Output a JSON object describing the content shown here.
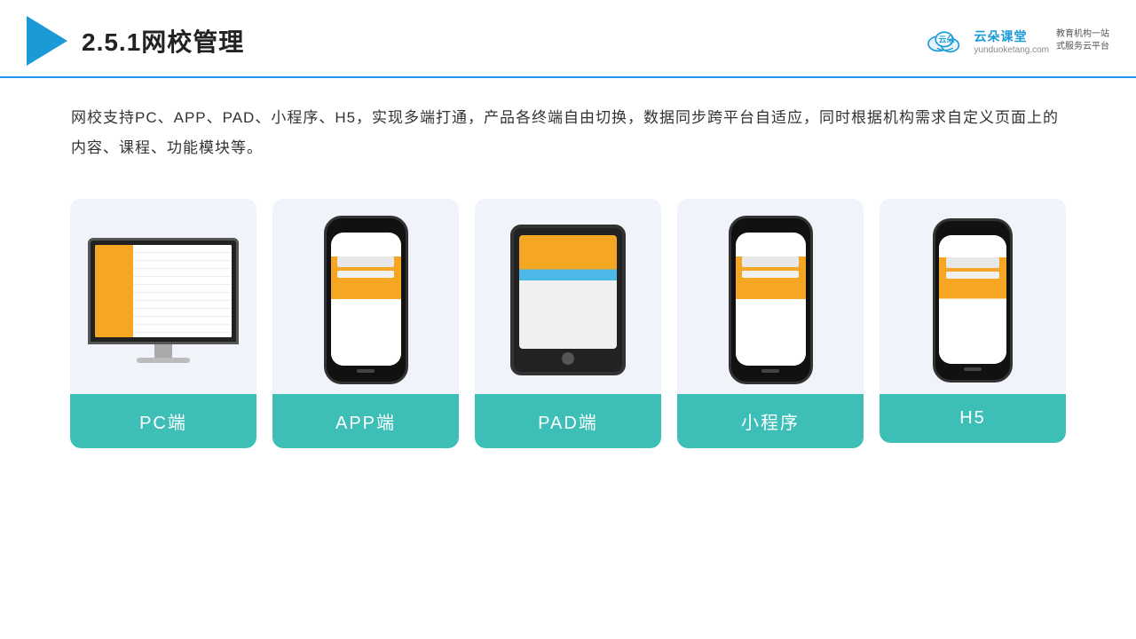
{
  "header": {
    "title": "2.5.1网校管理",
    "brand": {
      "name": "云朵课堂",
      "url": "yunduoketang.com",
      "slogan_line1": "教育机构一站",
      "slogan_line2": "式服务云平台"
    }
  },
  "description": {
    "text": "网校支持PC、APP、PAD、小程序、H5，实现多端打通，产品各终端自由切换，数据同步跨平台自适应，同时根据机构需求自定义页面上的内容、课程、功能模块等。"
  },
  "cards": [
    {
      "id": "pc",
      "label": "PC端",
      "device_type": "monitor"
    },
    {
      "id": "app",
      "label": "APP端",
      "device_type": "phone"
    },
    {
      "id": "pad",
      "label": "PAD端",
      "device_type": "tablet"
    },
    {
      "id": "miniprogram",
      "label": "小程序",
      "device_type": "phone"
    },
    {
      "id": "h5",
      "label": "H5",
      "device_type": "phone"
    }
  ]
}
